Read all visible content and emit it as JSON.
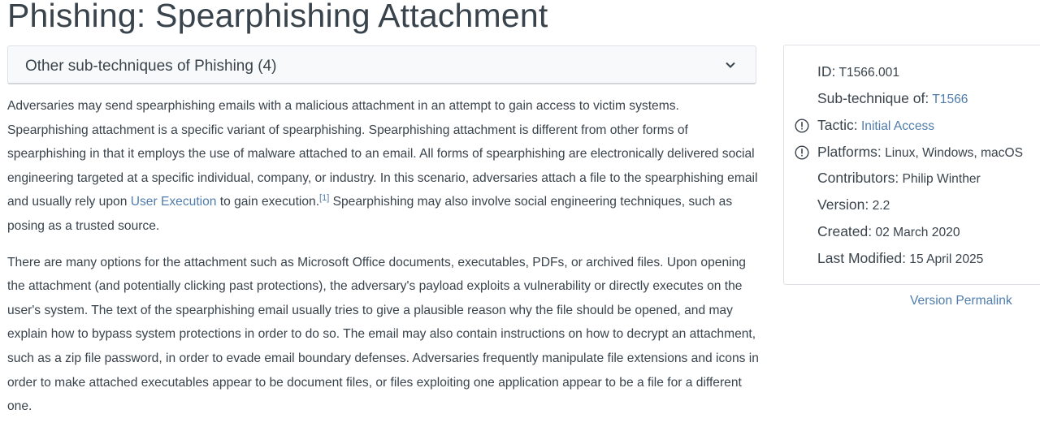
{
  "page": {
    "title": "Phishing: Spearphishing Attachment"
  },
  "subtechniques": {
    "label": "Other sub-techniques of Phishing",
    "count": "(4)"
  },
  "description": {
    "p1_part1": "Adversaries may send spearphishing emails with a malicious attachment in an attempt to gain access to victim systems. Spearphishing attachment is a specific variant of spearphishing. Spearphishing attachment is different from other forms of spearphishing in that it employs the use of malware attached to an email. All forms of spearphishing are electronically delivered social engineering targeted at a specific individual, company, or industry. In this scenario, adversaries attach a file to the spearphishing email and usually rely upon ",
    "p1_link": "User Execution",
    "p1_part2": " to gain execution.",
    "p1_ref": "[1]",
    "p1_part3": " Spearphishing may also involve social engineering techniques, such as posing as a trusted source.",
    "p2": "There are many options for the attachment such as Microsoft Office documents, executables, PDFs, or archived files. Upon opening the attachment (and potentially clicking past protections), the adversary's payload exploits a vulnerability or directly executes on the user's system. The text of the spearphishing email usually tries to give a plausible reason why the file should be opened, and may explain how to bypass system protections in order to do so. The email may also contain instructions on how to decrypt an attachment, such as a zip file password, in order to evade email boundary defenses. Adversaries frequently manipulate file extensions and icons in order to make attached executables appear to be document files, or files exploiting one application appear to be a file for a different one."
  },
  "card": {
    "id_label": "ID:",
    "id_value": "T1566.001",
    "subtech_label": "Sub-technique of:",
    "subtech_value": "T1566",
    "tactic_label": "Tactic:",
    "tactic_value": "Initial Access",
    "platforms_label": "Platforms:",
    "platforms_value": "Linux, Windows, macOS",
    "contributors_label": "Contributors:",
    "contributors_value": "Philip Winther",
    "version_label": "Version:",
    "version_value": "2.2",
    "created_label": "Created:",
    "created_value": "02 March 2020",
    "modified_label": "Last Modified:",
    "modified_value": "15 April 2025"
  },
  "permalink": {
    "label": "Version Permalink"
  },
  "colors": {
    "link": "#4f7cac",
    "text": "#39434c",
    "bar_bg": "#f8f9fa",
    "border": "#dee2e6"
  },
  "icons": {
    "chevron": "chevron-down-icon",
    "info": "info-icon"
  }
}
